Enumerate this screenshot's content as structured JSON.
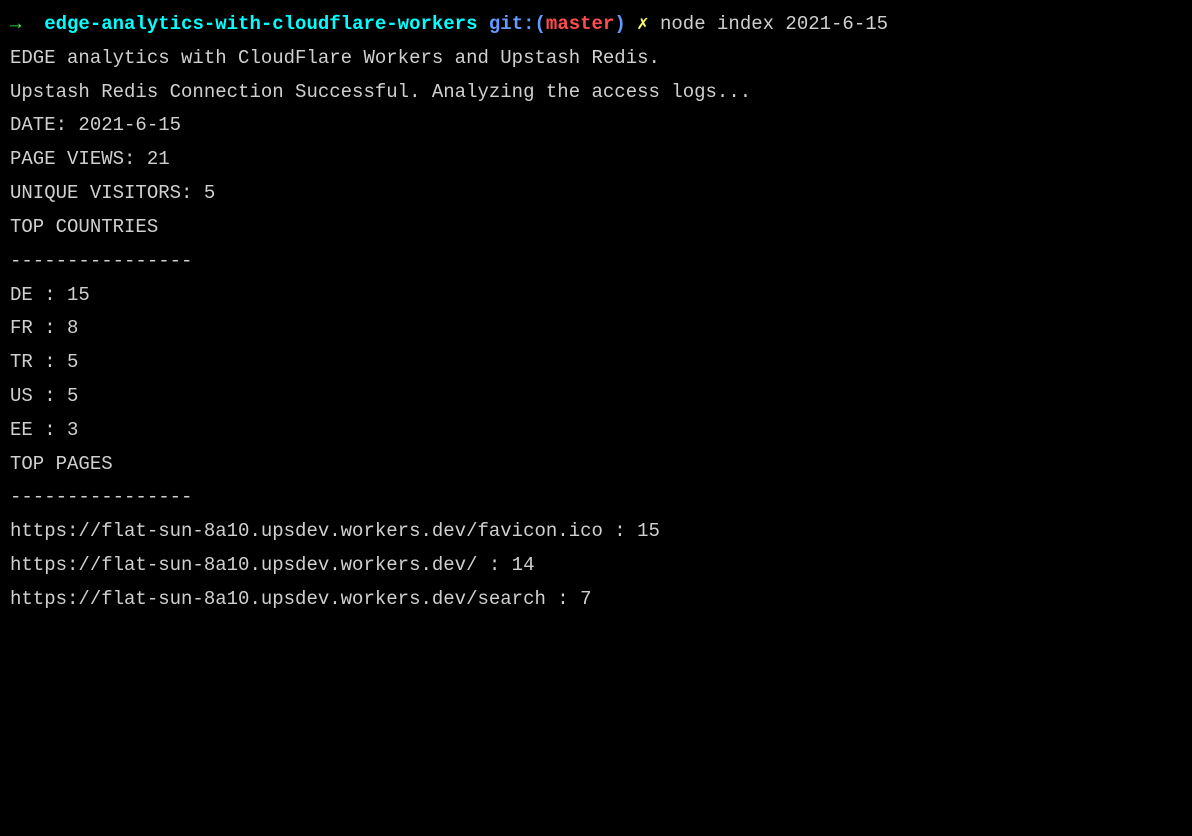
{
  "prompt": {
    "arrow": "→  ",
    "dir": "edge-analytics-with-cloudflare-workers",
    "git_label": " git:",
    "paren_open": "(",
    "branch": "master",
    "paren_close": ")",
    "x_mark": " ✗ ",
    "command": "node index 2021-6-15"
  },
  "lines": {
    "l1": "EDGE analytics with CloudFlare Workers and Upstash Redis.",
    "l2": "Upstash Redis Connection Successful. Analyzing the access logs...",
    "l3": "",
    "l4": "DATE: 2021-6-15",
    "l5": "",
    "l6": "PAGE VIEWS: 21",
    "l7": "",
    "l8": "UNIQUE VISITORS: 5",
    "l9": "",
    "l10": "TOP COUNTRIES",
    "l11": "----------------",
    "l12": "DE : 15",
    "l13": "FR : 8",
    "l14": "TR : 5",
    "l15": "US : 5",
    "l16": "EE : 3",
    "l17": "",
    "l18": "",
    "l19": "TOP PAGES",
    "l20": "----------------",
    "l21": "https://flat-sun-8a10.upsdev.workers.dev/favicon.ico : 15",
    "l22": "https://flat-sun-8a10.upsdev.workers.dev/ : 14",
    "l23": "https://flat-sun-8a10.upsdev.workers.dev/search : 7"
  }
}
